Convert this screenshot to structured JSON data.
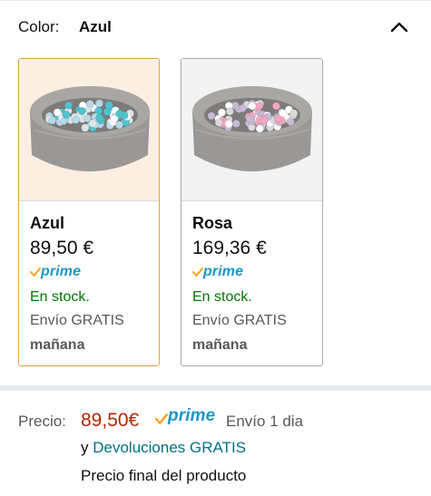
{
  "variation": {
    "label": "Color:",
    "selected_value": "Azul",
    "collapse_icon": "chevron-up-icon"
  },
  "options": [
    {
      "name": "Azul",
      "price": "89,50 €",
      "prime_label": "prime",
      "stock": "En stock.",
      "shipping": "Envío GRATIS",
      "delivery_day": "mañana",
      "selected": true,
      "ball_colors": [
        "#4fc3cf",
        "#ffffff",
        "#b7d9e8",
        "#dfe6ea"
      ]
    },
    {
      "name": "Rosa",
      "price": "169,36 €",
      "prime_label": "prime",
      "stock": "En stock.",
      "shipping": "Envío GRATIS",
      "delivery_day": "mañana",
      "selected": false,
      "ball_colors": [
        "#f2a7bf",
        "#ffffff",
        "#c9b9d6",
        "#d9d9de"
      ]
    }
  ],
  "summary": {
    "price_label": "Precio:",
    "price": "89,50€",
    "prime_label": "prime",
    "delivery": "Envío 1 dia",
    "returns_prefix": "y",
    "returns_link": "Devoluciones GRATIS",
    "final_price_note": "Precio final del producto"
  },
  "colors": {
    "accent_selected_border": "#e2a144",
    "prime_blue": "#1a98c7",
    "prime_check": "#f4a11d",
    "in_stock_green": "#007600",
    "price_red": "#b12704",
    "link_teal": "#007185"
  }
}
